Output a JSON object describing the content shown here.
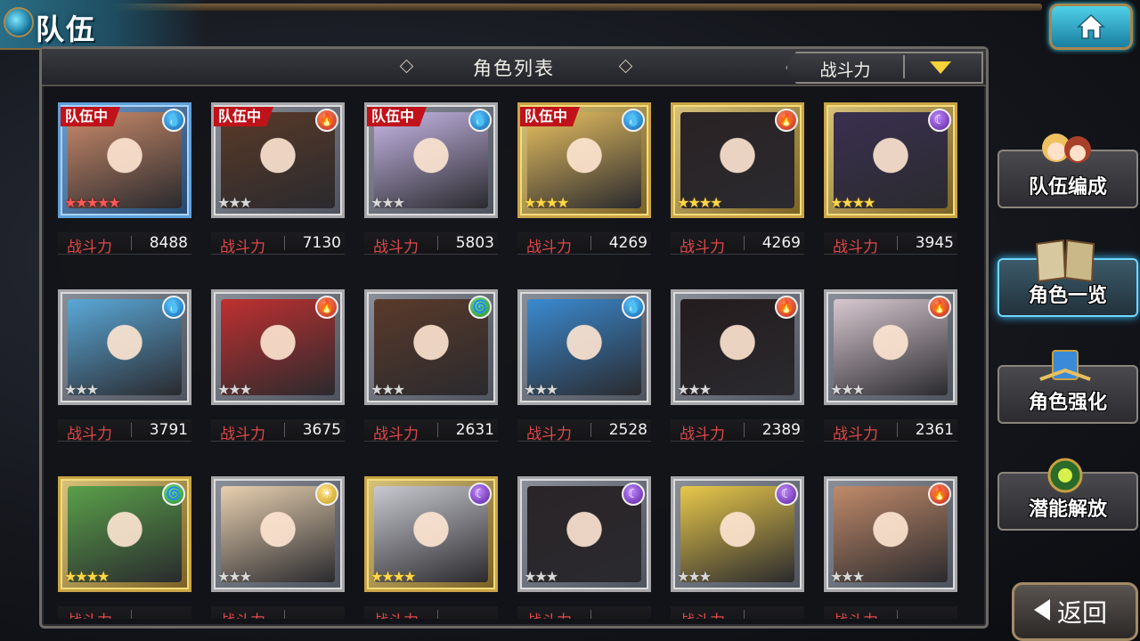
{
  "window": {
    "title": "队伍"
  },
  "panel": {
    "title": "角色列表"
  },
  "sort": {
    "selected": "战斗力"
  },
  "power_label": "战斗力",
  "cards": [
    {
      "tag": "队伍中",
      "element": "water",
      "frame": "blue",
      "stars": 5,
      "star_style": "red",
      "power": "8488",
      "hair": "#c98a6a"
    },
    {
      "tag": "队伍中",
      "element": "fire",
      "frame": "silver",
      "stars": 3,
      "star_style": "off",
      "power": "7130",
      "hair": "#5a3a28"
    },
    {
      "tag": "队伍中",
      "element": "water",
      "frame": "silver",
      "stars": 3,
      "star_style": "off",
      "power": "5803",
      "hair": "#c8b8e8"
    },
    {
      "tag": "队伍中",
      "element": "water",
      "frame": "gold",
      "stars": 4,
      "star_style": "on",
      "power": "4269",
      "hair": "#e8c060"
    },
    {
      "tag": "",
      "element": "fire",
      "frame": "gold",
      "stars": 4,
      "star_style": "on",
      "power": "4269",
      "hair": "#2a2224"
    },
    {
      "tag": "",
      "element": "dark",
      "frame": "gold",
      "stars": 4,
      "star_style": "on",
      "power": "3945",
      "hair": "#3a3050"
    },
    {
      "tag": "",
      "element": "water",
      "frame": "silver",
      "stars": 3,
      "star_style": "off",
      "power": "3791",
      "hair": "#5aa8d8"
    },
    {
      "tag": "",
      "element": "fire",
      "frame": "silver",
      "stars": 3,
      "star_style": "off",
      "power": "3675",
      "hair": "#c03030"
    },
    {
      "tag": "",
      "element": "wind",
      "frame": "silver",
      "stars": 3,
      "star_style": "off",
      "power": "2631",
      "hair": "#5a3a2a"
    },
    {
      "tag": "",
      "element": "water",
      "frame": "silver",
      "stars": 3,
      "star_style": "off",
      "power": "2528",
      "hair": "#3a8ad0"
    },
    {
      "tag": "",
      "element": "fire",
      "frame": "silver",
      "stars": 3,
      "star_style": "off",
      "power": "2389",
      "hair": "#241c1e"
    },
    {
      "tag": "",
      "element": "fire",
      "frame": "silver",
      "stars": 3,
      "star_style": "off",
      "power": "2361",
      "hair": "#d8c8d0"
    },
    {
      "tag": "",
      "element": "wind",
      "frame": "gold",
      "stars": 4,
      "star_style": "on",
      "power": "",
      "hair": "#5aa04a"
    },
    {
      "tag": "",
      "element": "light",
      "frame": "silver",
      "stars": 3,
      "star_style": "off",
      "power": "",
      "hair": "#e8d0b0"
    },
    {
      "tag": "",
      "element": "dark",
      "frame": "gold",
      "stars": 4,
      "star_style": "on",
      "power": "",
      "hair": "#c8c8d0"
    },
    {
      "tag": "",
      "element": "dark",
      "frame": "silver",
      "stars": 3,
      "star_style": "off",
      "power": "",
      "hair": "#2a2428"
    },
    {
      "tag": "",
      "element": "dark",
      "frame": "silver",
      "stars": 3,
      "star_style": "off",
      "power": "",
      "hair": "#e8c84a"
    },
    {
      "tag": "",
      "element": "fire",
      "frame": "silver",
      "stars": 3,
      "star_style": "off",
      "power": "",
      "hair": "#c08a6a"
    }
  ],
  "side_menu": {
    "team_edit": "队伍编成",
    "character_list": "角色一览",
    "character_enhance": "角色强化",
    "potential_unlock": "潜能解放"
  },
  "back": {
    "label": "返回"
  },
  "colors": {
    "accent": "#3ec4ff",
    "power_label": "#e04848",
    "team_tag": "#c0121a"
  }
}
